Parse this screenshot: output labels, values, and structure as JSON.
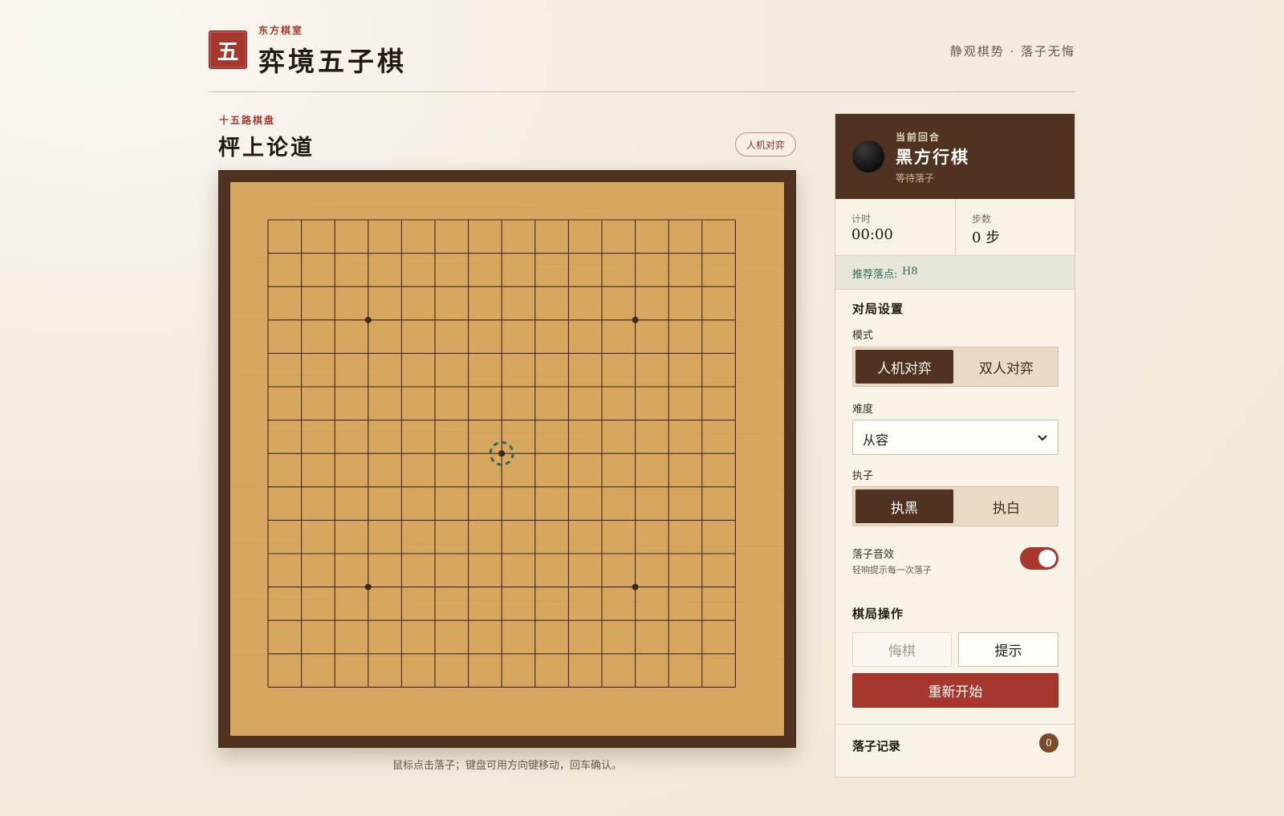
{
  "header": {
    "logo_char": "五",
    "brand_sub": "东方棋室",
    "brand_title": "弈境五子棋",
    "motto": "静观棋势 · 落子无悔"
  },
  "board": {
    "subtitle": "十五路棋盘",
    "title": "枰上论道",
    "mode_pill": "人机对弈",
    "hint": "鼠标点击落子；键盘可用方向键移动，回车确认。",
    "size": 15,
    "star_points": [
      [
        3,
        3
      ],
      [
        11,
        3
      ],
      [
        7,
        7
      ],
      [
        3,
        11
      ],
      [
        11,
        11
      ]
    ],
    "cursor": [
      7,
      7
    ],
    "colors": {
      "wood": "#d7a75f",
      "frame": "#4f321f",
      "line": "#3b2a1c",
      "cursor": "#2f6a62"
    }
  },
  "panel": {
    "turn": {
      "label": "当前回合",
      "title": "黑方行棋",
      "status": "等待落子"
    },
    "timer": {
      "label": "计时",
      "value": "00:00"
    },
    "steps": {
      "label": "步数",
      "value": "0 步"
    },
    "suggest": {
      "label": "推荐落点:",
      "value": "H8"
    },
    "settings": {
      "title": "对局设置",
      "mode": {
        "label": "模式",
        "options": [
          "人机对弈",
          "双人对弈"
        ],
        "active": 0
      },
      "difficulty": {
        "label": "难度",
        "value": "从容"
      },
      "side": {
        "label": "执子",
        "options": [
          "执黑",
          "执白"
        ],
        "active": 0
      },
      "sound": {
        "label": "落子音效",
        "desc": "轻响提示每一次落子",
        "on": true
      }
    },
    "actions": {
      "title": "棋局操作",
      "undo": "悔棋",
      "hint": "提示",
      "restart": "重新开始"
    },
    "log": {
      "title": "落子记录",
      "count": "0"
    },
    "colors": {
      "accent": "#a7372d",
      "dark": "#4f321f"
    }
  }
}
